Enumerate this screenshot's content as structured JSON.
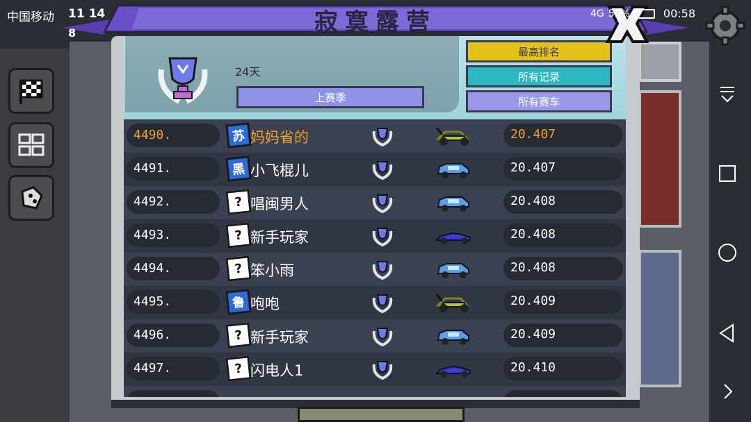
{
  "status_bar": {
    "carrier": "中国移动",
    "coins": "11 14",
    "gems": "8",
    "network": "4G",
    "battery": "50%",
    "time": "00:58"
  },
  "title": "寂寞露营",
  "header": {
    "days": "24天",
    "last_season_button": "上赛季",
    "top_rank_button": "最高排名",
    "all_records_button": "所有记录",
    "all_cars_button": "所有赛车"
  },
  "leaderboard": [
    {
      "rank": "4490.",
      "badge": "苏",
      "badge_type": "blue",
      "name": "妈妈省的",
      "car": "buggy-green",
      "time": "20.407",
      "me": true
    },
    {
      "rank": "4491.",
      "badge": "黑",
      "badge_type": "blue",
      "name": "小飞棍儿",
      "car": "suv-blue",
      "time": "20.407",
      "me": false
    },
    {
      "rank": "4492.",
      "badge": "?",
      "badge_type": "unknown",
      "name": "唱闽男人",
      "car": "suv-blue",
      "time": "20.408",
      "me": false
    },
    {
      "rank": "4493.",
      "badge": "?",
      "badge_type": "unknown",
      "name": "新手玩家",
      "car": "sports-car-blue",
      "time": "20.408",
      "me": false
    },
    {
      "rank": "4494.",
      "badge": "?",
      "badge_type": "unknown",
      "name": "笨小雨",
      "car": "suv-blue",
      "time": "20.408",
      "me": false
    },
    {
      "rank": "4495.",
      "badge": "鲁",
      "badge_type": "blue",
      "name": "咆咆",
      "car": "buggy-green",
      "time": "20.409",
      "me": false
    },
    {
      "rank": "4496.",
      "badge": "?",
      "badge_type": "unknown",
      "name": "新手玩家",
      "car": "suv-blue",
      "time": "20.409",
      "me": false
    },
    {
      "rank": "4497.",
      "badge": "?",
      "badge_type": "unknown",
      "name": "闪电人1",
      "car": "sports-car-blue",
      "time": "20.410",
      "me": false
    }
  ],
  "colors": {
    "highlight_text": "#f0a030",
    "yellow_button": "#e5c21a",
    "teal_button": "#2db7c0",
    "purple_button": "#8f93e8",
    "banner_purple": "#5a3fb0"
  },
  "icons": {
    "left_rail": [
      "checkered-flag-icon",
      "grid-icon",
      "dice-icon"
    ],
    "nav_bar": [
      "pull-down-icon",
      "square-icon",
      "circle-icon",
      "back-triangle-icon",
      "chevron-right-icon"
    ],
    "top_right": "gear-icon",
    "close": "close-icon"
  }
}
